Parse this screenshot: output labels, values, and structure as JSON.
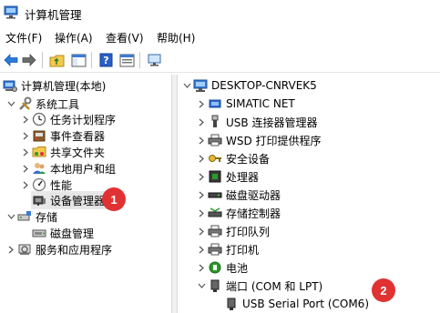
{
  "window": {
    "title": "计算机管理",
    "icon": "computer-management-icon"
  },
  "menu": {
    "items": [
      {
        "label": "文件(F)"
      },
      {
        "label": "操作(A)"
      },
      {
        "label": "查看(V)"
      },
      {
        "label": "帮助(H)"
      }
    ]
  },
  "toolbar": {
    "buttons": [
      "back-arrow-icon",
      "forward-arrow-icon",
      "up-folder-icon",
      "show-hide-tree-icon",
      "help-icon",
      "properties-icon",
      "monitor-icon"
    ]
  },
  "tree": {
    "root": {
      "label": "计算机管理(本地)",
      "icon": "computer-management-icon"
    },
    "system_tools": {
      "label": "系统工具",
      "icon": "tools-icon"
    },
    "task_scheduler": {
      "label": "任务计划程序",
      "icon": "clock-icon"
    },
    "event_viewer": {
      "label": "事件查看器",
      "icon": "event-viewer-icon"
    },
    "shared_folders": {
      "label": "共享文件夹",
      "icon": "shared-folder-icon"
    },
    "local_users": {
      "label": "本地用户和组",
      "icon": "users-icon"
    },
    "performance": {
      "label": "性能",
      "icon": "performance-icon"
    },
    "device_manager": {
      "label": "设备管理器",
      "icon": "device-manager-icon",
      "selected": true
    },
    "storage": {
      "label": "存储",
      "icon": "storage-icon"
    },
    "disk_management": {
      "label": "磁盘管理",
      "icon": "disk-icon"
    },
    "services": {
      "label": "服务和应用程序",
      "icon": "services-icon"
    }
  },
  "devices": {
    "computer": {
      "label": "DESKTOP-CNRVEK5",
      "icon": "computer-icon"
    },
    "items": [
      {
        "label": "SIMATIC NET",
        "icon": "network-icon"
      },
      {
        "label": "USB 连接器管理器",
        "icon": "usb-icon"
      },
      {
        "label": "WSD 打印提供程序",
        "icon": "printer-icon"
      },
      {
        "label": "安全设备",
        "icon": "security-key-icon"
      },
      {
        "label": "处理器",
        "icon": "processor-icon"
      },
      {
        "label": "磁盘驱动器",
        "icon": "disk-drive-icon"
      },
      {
        "label": "存储控制器",
        "icon": "storage-controller-icon"
      },
      {
        "label": "打印队列",
        "icon": "print-queue-icon"
      },
      {
        "label": "打印机",
        "icon": "printer-icon"
      },
      {
        "label": "电池",
        "icon": "battery-icon"
      },
      {
        "label": "端口 (COM 和 LPT)",
        "icon": "port-icon",
        "expanded": true
      }
    ],
    "port_child": {
      "label": "USB Serial Port (COM6)",
      "icon": "port-icon"
    }
  },
  "annotations": [
    {
      "label": "1",
      "color": "#e03232"
    },
    {
      "label": "2",
      "color": "#e03232"
    }
  ]
}
